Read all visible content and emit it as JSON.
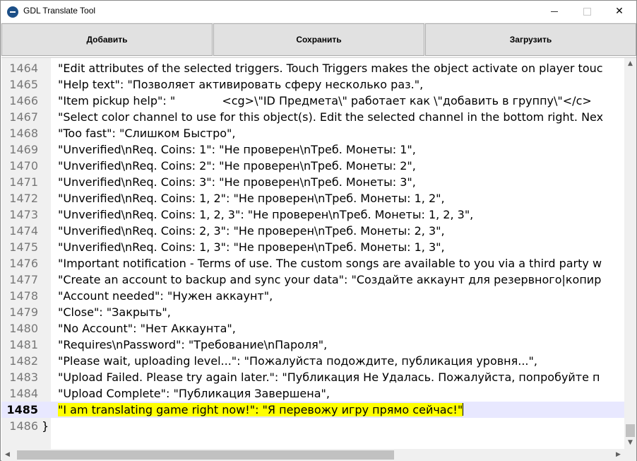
{
  "window": {
    "title": "GDL Translate Tool",
    "controls": {
      "minimize": "—",
      "maximize": "☐",
      "close": "✕"
    }
  },
  "toolbar": {
    "add_label": "Добавить",
    "save_label": "Сохранить",
    "load_label": "Загрузить"
  },
  "editor": {
    "current_line": 1485,
    "lines": [
      {
        "num": "1464",
        "text": "\"Edit attributes of the selected triggers. Touch Triggers makes the object activate on player touc"
      },
      {
        "num": "1465",
        "text": "\"Help text\": \"Позволяет активировать сферу несколько раз.\","
      },
      {
        "num": "1466",
        "text": "\"Item pickup help\": \"             <cg>\\\"ID Предмета\\\" работает как \\\"добавить в группу\\\"</c>"
      },
      {
        "num": "1467",
        "text": "\"Select color channel to use for this object(s). Edit the selected channel in the bottom right. Nex"
      },
      {
        "num": "1468",
        "text": "\"Too fast\": \"Слишком Быстро\","
      },
      {
        "num": "1469",
        "text": "\"Unverified\\nReq. Coins: 1\": \"Не проверен\\nТреб. Монеты: 1\","
      },
      {
        "num": "1470",
        "text": "\"Unverified\\nReq. Coins: 2\": \"Не проверен\\nТреб. Монеты: 2\","
      },
      {
        "num": "1471",
        "text": "\"Unverified\\nReq. Coins: 3\": \"Не проверен\\nТреб. Монеты: 3\","
      },
      {
        "num": "1472",
        "text": "\"Unverified\\nReq. Coins: 1, 2\": \"Не проверен\\nТреб. Монеты: 1, 2\","
      },
      {
        "num": "1473",
        "text": "\"Unverified\\nReq. Coins: 1, 2, 3\": \"Не проверен\\nТреб. Монеты: 1, 2, 3\","
      },
      {
        "num": "1474",
        "text": "\"Unverified\\nReq. Coins: 2, 3\": \"Не проверен\\nТреб. Монеты: 2, 3\","
      },
      {
        "num": "1475",
        "text": "\"Unverified\\nReq. Coins: 1, 3\": \"Не проверен\\nТреб. Монеты: 1, 3\","
      },
      {
        "num": "1476",
        "text": "\"Important notification - Terms of use. The custom songs are available to you via a third party w"
      },
      {
        "num": "1477",
        "text": "\"Create an account to backup and sync your data\": \"Создайте аккаунт для резервного|копир"
      },
      {
        "num": "1478",
        "text": "\"Account needed\": \"Нужен аккаунт\","
      },
      {
        "num": "1479",
        "text": "\"Close\": \"Закрыть\","
      },
      {
        "num": "1480",
        "text": "\"No Account\": \"Нет Аккаунта\","
      },
      {
        "num": "1481",
        "text": "\"Requires\\nPassword\": \"Требование\\nПароля\","
      },
      {
        "num": "1482",
        "text": "\"Please wait, uploading level...\": \"Пожалуйста подождите, публикация уровня...\","
      },
      {
        "num": "1483",
        "text": "\"Upload Failed. Please try again later.\": \"Публикация Не Удалась. Пожалуйста, попробуйте п"
      },
      {
        "num": "1484",
        "text": "\"Upload Complete\": \"Публикация Завершена\","
      },
      {
        "num": "1485",
        "text": "\"I am translating game right now!\": \"Я перевожу игру прямо сейчас!\""
      },
      {
        "num": "1486",
        "text": "}"
      }
    ],
    "highlight_color": "#ffff00",
    "scrollbar": {
      "up": "▲",
      "down": "▼",
      "left": "◀",
      "right": "▶"
    }
  }
}
